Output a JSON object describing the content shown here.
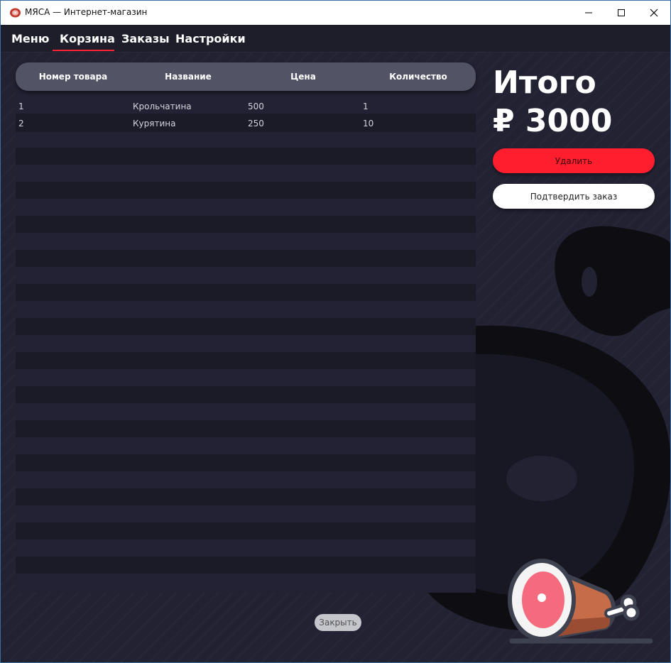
{
  "window": {
    "title": "МЯСА — Интернет-магазин",
    "controls": {
      "minimize": "minimize-icon",
      "maximize": "maximize-icon",
      "close": "close-icon"
    }
  },
  "nav": {
    "items": [
      {
        "label": "Меню"
      },
      {
        "label": "Корзина",
        "active": true
      },
      {
        "label": "Заказы"
      },
      {
        "label": "Настройки"
      }
    ]
  },
  "cart_table": {
    "columns": [
      "Номер товара",
      "Название",
      "Цена",
      "Количество"
    ],
    "rows": [
      [
        "1",
        "Крольчатина",
        "500",
        "1"
      ],
      [
        "2",
        "Курятина",
        "250",
        "10"
      ]
    ]
  },
  "summary": {
    "total_label": "Итого",
    "total_amount": "₽ 3000"
  },
  "buttons": {
    "delete": "Удалить",
    "confirm": "Подтвердить заказ",
    "close": "Закрыть"
  },
  "colors": {
    "accent": "#ff1e2d",
    "background": "#222233",
    "header": "#525466"
  },
  "icons": {
    "app": "meat-icon",
    "decor": "ham-icon"
  }
}
